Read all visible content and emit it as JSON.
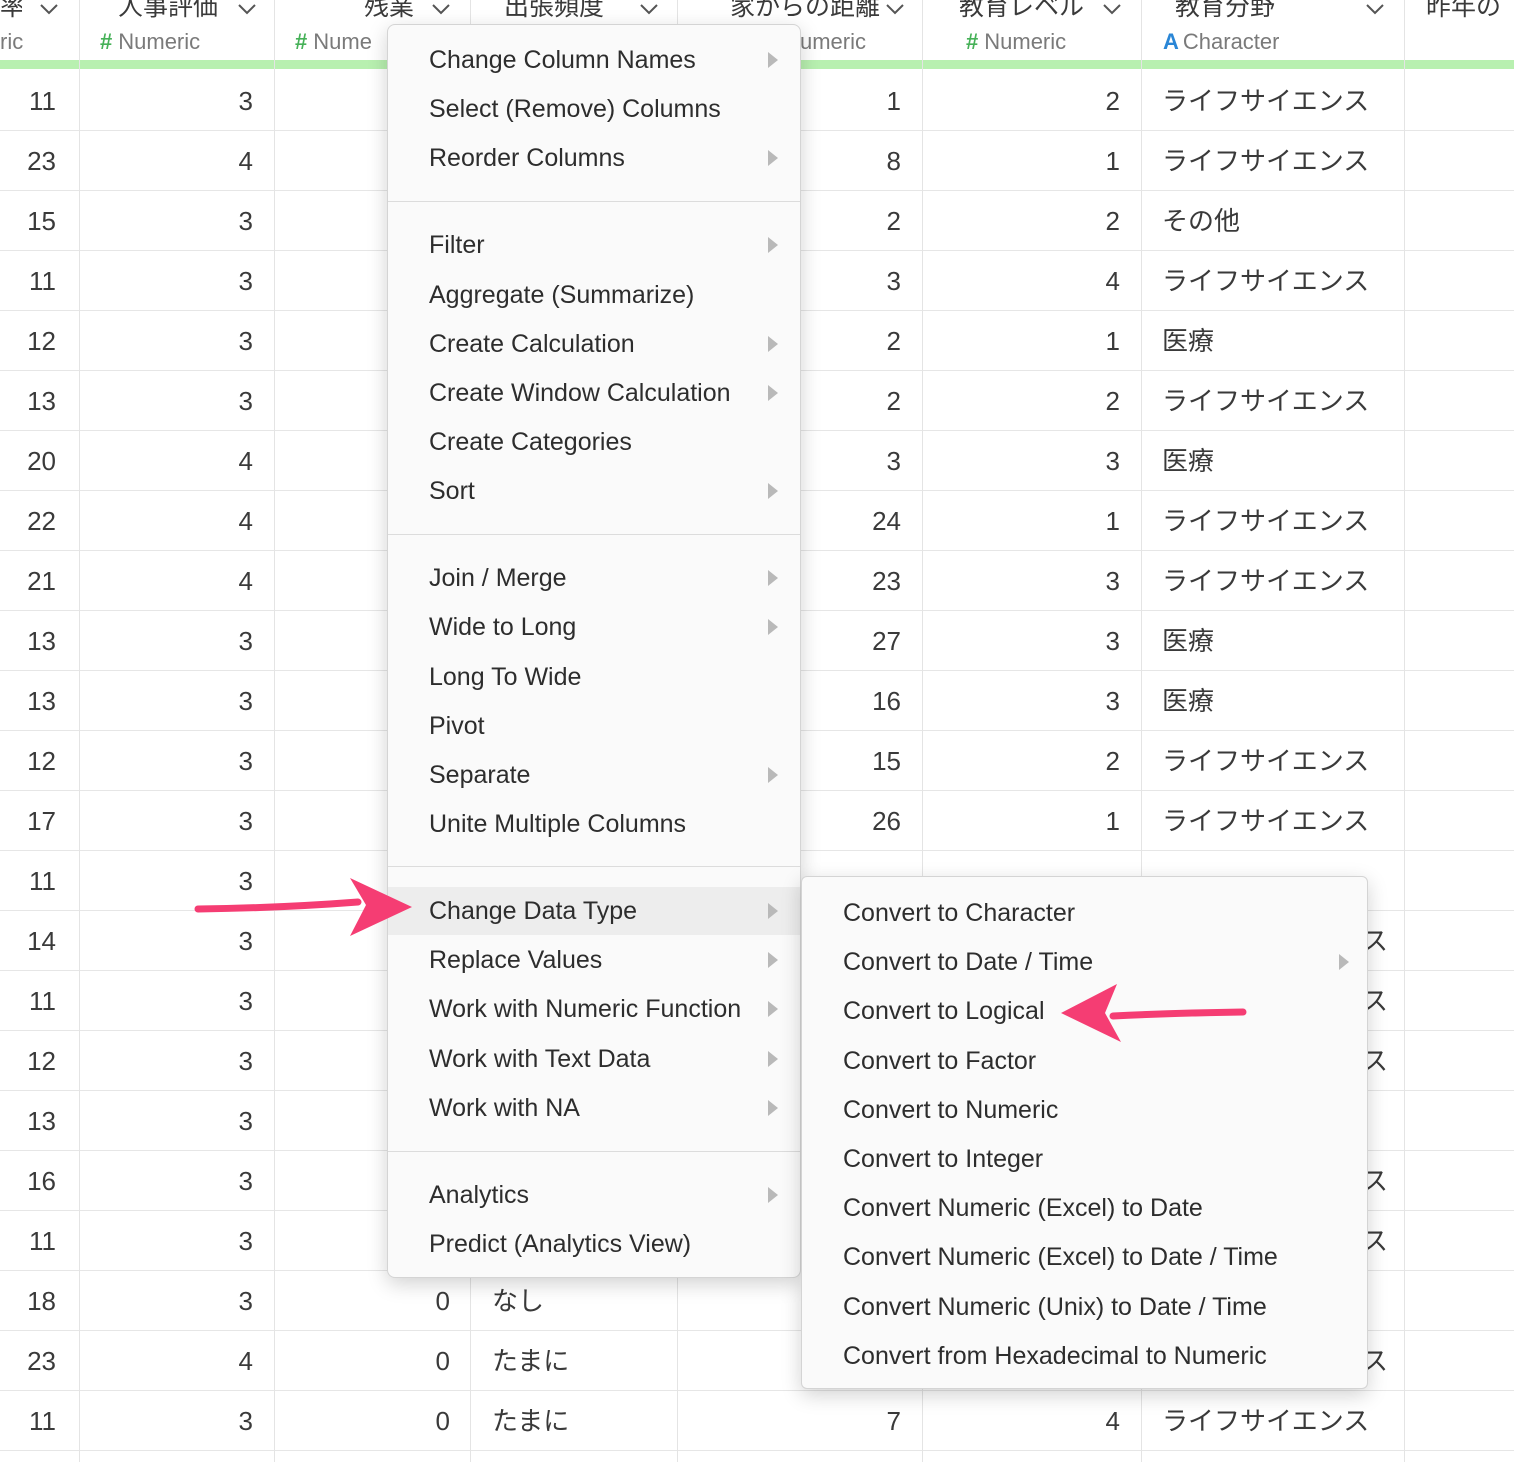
{
  "columns": [
    {
      "name": "率",
      "type_sym": "",
      "type_label": "ric",
      "kind": "num"
    },
    {
      "name": "人事評価",
      "type_sym": "#",
      "type_label": "Numeric",
      "kind": "num"
    },
    {
      "name": "残業",
      "type_sym": "#",
      "type_label": "Nume",
      "kind": "num"
    },
    {
      "name": "出張頻度",
      "type_sym": "",
      "type_label": "",
      "kind": "txt"
    },
    {
      "name": "家からの距離",
      "type_sym": "",
      "type_label": "umeric",
      "kind": "num"
    },
    {
      "name": "教育レベル",
      "type_sym": "#",
      "type_label": "Numeric",
      "kind": "num"
    },
    {
      "name": "教育分野",
      "type_sym": "A",
      "type_label": "Character",
      "kind": "txt"
    },
    {
      "name": "昨年の",
      "type_sym": "",
      "type_label": "",
      "kind": "txt"
    }
  ],
  "rows": [
    [
      "11",
      "3",
      "",
      "",
      "1",
      "2",
      "ライフサイエンス"
    ],
    [
      "23",
      "4",
      "",
      "",
      "8",
      "1",
      "ライフサイエンス"
    ],
    [
      "15",
      "3",
      "",
      "",
      "2",
      "2",
      "その他"
    ],
    [
      "11",
      "3",
      "",
      "",
      "3",
      "4",
      "ライフサイエンス"
    ],
    [
      "12",
      "3",
      "",
      "",
      "2",
      "1",
      "医療"
    ],
    [
      "13",
      "3",
      "",
      "",
      "2",
      "2",
      "ライフサイエンス"
    ],
    [
      "20",
      "4",
      "",
      "",
      "3",
      "3",
      "医療"
    ],
    [
      "22",
      "4",
      "",
      "",
      "24",
      "1",
      "ライフサイエンス"
    ],
    [
      "21",
      "4",
      "",
      "",
      "23",
      "3",
      "ライフサイエンス"
    ],
    [
      "13",
      "3",
      "",
      "",
      "27",
      "3",
      "医療"
    ],
    [
      "13",
      "3",
      "",
      "",
      "16",
      "3",
      "医療"
    ],
    [
      "12",
      "3",
      "",
      "",
      "15",
      "2",
      "ライフサイエンス"
    ],
    [
      "17",
      "3",
      "",
      "",
      "26",
      "1",
      "ライフサイエンス"
    ],
    [
      "11",
      "3",
      "",
      "",
      "",
      "",
      ""
    ],
    [
      "14",
      "3",
      "",
      "",
      "",
      "",
      "ス"
    ],
    [
      "11",
      "3",
      "",
      "",
      "",
      "",
      "ス"
    ],
    [
      "12",
      "3",
      "",
      "",
      "",
      "",
      "ス"
    ],
    [
      "13",
      "3",
      "",
      "",
      "",
      "",
      ""
    ],
    [
      "16",
      "3",
      "",
      "",
      "",
      "",
      "ス"
    ],
    [
      "11",
      "3",
      "",
      "",
      "",
      "",
      "ス"
    ],
    [
      "18",
      "3",
      "0",
      "なし",
      "",
      "",
      ""
    ],
    [
      "23",
      "4",
      "0",
      "たまに",
      "",
      "",
      "ス"
    ],
    [
      "11",
      "3",
      "0",
      "たまに",
      "7",
      "4",
      "ライフサイエンス"
    ]
  ],
  "main_menu": {
    "items": [
      {
        "label": "Change Column Names",
        "submenu": true,
        "name": "menu-change-column-names"
      },
      {
        "label": "Select (Remove) Columns",
        "submenu": false,
        "name": "menu-select-remove-columns"
      },
      {
        "label": "Reorder Columns",
        "submenu": true,
        "name": "menu-reorder-columns"
      },
      {
        "label": "Filter",
        "submenu": true,
        "name": "menu-filter"
      },
      {
        "label": "Aggregate (Summarize)",
        "submenu": false,
        "name": "menu-aggregate"
      },
      {
        "label": "Create Calculation",
        "submenu": true,
        "name": "menu-create-calculation"
      },
      {
        "label": "Create Window Calculation",
        "submenu": true,
        "name": "menu-create-window-calculation"
      },
      {
        "label": "Create Categories",
        "submenu": false,
        "name": "menu-create-categories"
      },
      {
        "label": "Sort",
        "submenu": true,
        "name": "menu-sort"
      },
      {
        "label": "Join / Merge",
        "submenu": true,
        "name": "menu-join-merge"
      },
      {
        "label": "Wide to Long",
        "submenu": true,
        "name": "menu-wide-to-long"
      },
      {
        "label": "Long To Wide",
        "submenu": false,
        "name": "menu-long-to-wide"
      },
      {
        "label": "Pivot",
        "submenu": false,
        "name": "menu-pivot"
      },
      {
        "label": "Separate",
        "submenu": true,
        "name": "menu-separate"
      },
      {
        "label": "Unite Multiple Columns",
        "submenu": false,
        "name": "menu-unite-multiple-columns"
      },
      {
        "label": "Change Data Type",
        "submenu": true,
        "name": "menu-change-data-type",
        "active": true
      },
      {
        "label": "Replace Values",
        "submenu": true,
        "name": "menu-replace-values"
      },
      {
        "label": "Work with Numeric Function",
        "submenu": true,
        "name": "menu-work-with-numeric-function"
      },
      {
        "label": "Work with Text Data",
        "submenu": true,
        "name": "menu-work-with-text-data"
      },
      {
        "label": "Work with NA",
        "submenu": true,
        "name": "menu-work-with-na"
      },
      {
        "label": "Analytics",
        "submenu": true,
        "name": "menu-analytics"
      },
      {
        "label": "Predict (Analytics View)",
        "submenu": false,
        "name": "menu-predict"
      }
    ]
  },
  "sub_menu": {
    "items": [
      {
        "label": "Convert to Character",
        "submenu": false,
        "name": "submenu-convert-to-character"
      },
      {
        "label": "Convert to Date / Time",
        "submenu": true,
        "name": "submenu-convert-to-date-time"
      },
      {
        "label": "Convert to Logical",
        "submenu": false,
        "name": "submenu-convert-to-logical"
      },
      {
        "label": "Convert to Factor",
        "submenu": false,
        "name": "submenu-convert-to-factor"
      },
      {
        "label": "Convert to Numeric",
        "submenu": false,
        "name": "submenu-convert-to-numeric"
      },
      {
        "label": "Convert to Integer",
        "submenu": false,
        "name": "submenu-convert-to-integer"
      },
      {
        "label": "Convert Numeric (Excel) to Date",
        "submenu": false,
        "name": "submenu-convert-excel-to-date"
      },
      {
        "label": "Convert Numeric (Excel) to Date / Time",
        "submenu": false,
        "name": "submenu-convert-excel-to-datetime"
      },
      {
        "label": "Convert Numeric (Unix) to Date / Time",
        "submenu": false,
        "name": "submenu-convert-unix-to-datetime"
      },
      {
        "label": "Convert from Hexadecimal to Numeric",
        "submenu": false,
        "name": "submenu-convert-hex-to-numeric"
      }
    ]
  },
  "colors": {
    "accent_arrow": "#f53d73",
    "quality_bar": "#b8f0b0",
    "numeric_symbol": "#46b158",
    "character_symbol": "#2a86d6"
  }
}
